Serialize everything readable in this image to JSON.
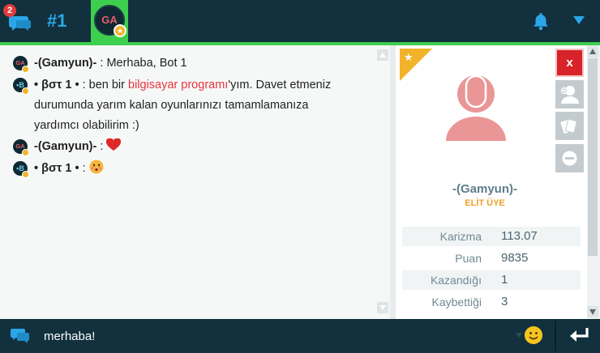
{
  "topbar": {
    "chat_badge_count": "2",
    "room_number": "#1",
    "active_tab_initials": "GA",
    "accent_green": "#3ecf4e",
    "bar_color": "#12303d"
  },
  "chat": {
    "messages": [
      {
        "avatar": "GA",
        "nick": "-(Gamyun)-",
        "sep": " : ",
        "text": "Merhaba, Bot 1"
      },
      {
        "avatar": "•B",
        "nick": "• βστ 1 •",
        "sep": " : ",
        "text_before": "ben bir ",
        "link": "bilgisayar programı",
        "text_after": "'yım. Davet etmeniz",
        "cont1": "durumunda yarım kalan oyunlarınızı tamamlamanıza",
        "cont2": "yardımcı  olabilirim :)"
      },
      {
        "avatar": "GA",
        "nick": "-(Gamyun)-",
        "sep": " : ",
        "emoji": "heart"
      },
      {
        "avatar": "•B",
        "nick": "• βστ 1 •",
        "sep": " : ",
        "emoji": "kissing-face"
      }
    ]
  },
  "profile": {
    "name": "-(Gamyun)-",
    "rank": "ELİT ÜYE",
    "stats": [
      {
        "label": "Karizma",
        "value": "113.07"
      },
      {
        "label": "Puan",
        "value": "9835"
      },
      {
        "label": "Kazandığı",
        "value": "1"
      },
      {
        "label": "Kaybettiği",
        "value": "3"
      }
    ],
    "close_label": "x"
  },
  "input": {
    "value": "merhaba!"
  }
}
